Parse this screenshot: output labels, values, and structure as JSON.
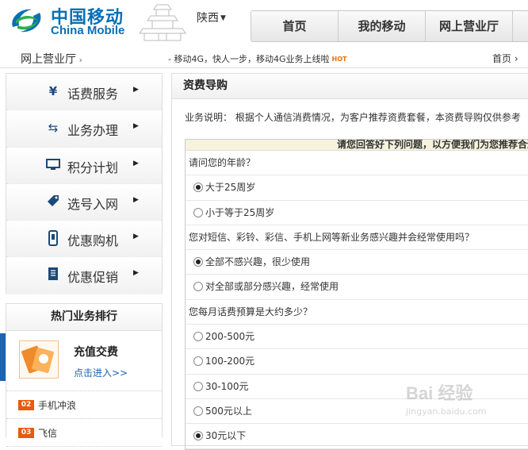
{
  "header": {
    "logo_zh": "中国移动",
    "logo_en": "China Mobile",
    "region": "陕西",
    "nav": [
      "首页",
      "我的移动",
      "网上营业厅"
    ]
  },
  "subbar": {
    "section_title": "网上营业厅",
    "ticker": "- 移动4G，快人一步，移动4G业务上线啦",
    "hot": "HOT",
    "breadcrumb": "首页 ›"
  },
  "sidebar": {
    "items": [
      {
        "label": "话费服务",
        "icon": "yen-icon"
      },
      {
        "label": "业务办理",
        "icon": "exchange-icon"
      },
      {
        "label": "积分计划",
        "icon": "monitor-icon"
      },
      {
        "label": "选号入网",
        "icon": "tag-icon"
      },
      {
        "label": "优惠购机",
        "icon": "phone-icon"
      },
      {
        "label": "优惠促销",
        "icon": "document-icon"
      }
    ]
  },
  "hot_services": {
    "title": "热门业务排行",
    "featured_name": "充值交费",
    "featured_link": "点击进入>>",
    "ranks": [
      {
        "num": "02",
        "name": "手机冲浪"
      },
      {
        "num": "03",
        "name": "飞信"
      }
    ]
  },
  "main": {
    "title": "资费导购",
    "description": "业务说明：  根据个人通信消费情况，为客户推荐资费套餐，本资费导购仅供参考",
    "panel_header": "请您回答好下列问题，以方便我们为您推荐合适",
    "q1": "请问您的年龄？",
    "q1_options": [
      "大于25周岁",
      "小于等于25周岁"
    ],
    "q1_selected": 0,
    "q2": "您对短信、彩铃、彩信、手机上网等新业务感兴趣并会经常使用吗？",
    "q2_options": [
      "全部不感兴趣，很少使用",
      "对全部或部分感兴趣，经常使用"
    ],
    "q2_selected": 0,
    "q3": "您每月话费预算是大约多少？",
    "q3_options": [
      "200-500元",
      "100-200元",
      "30-100元",
      "500元以上",
      "30元以下"
    ],
    "q3_selected": 4
  },
  "watermark": {
    "brand": "Bai 经验",
    "url": "jingyan.baidu.com"
  }
}
